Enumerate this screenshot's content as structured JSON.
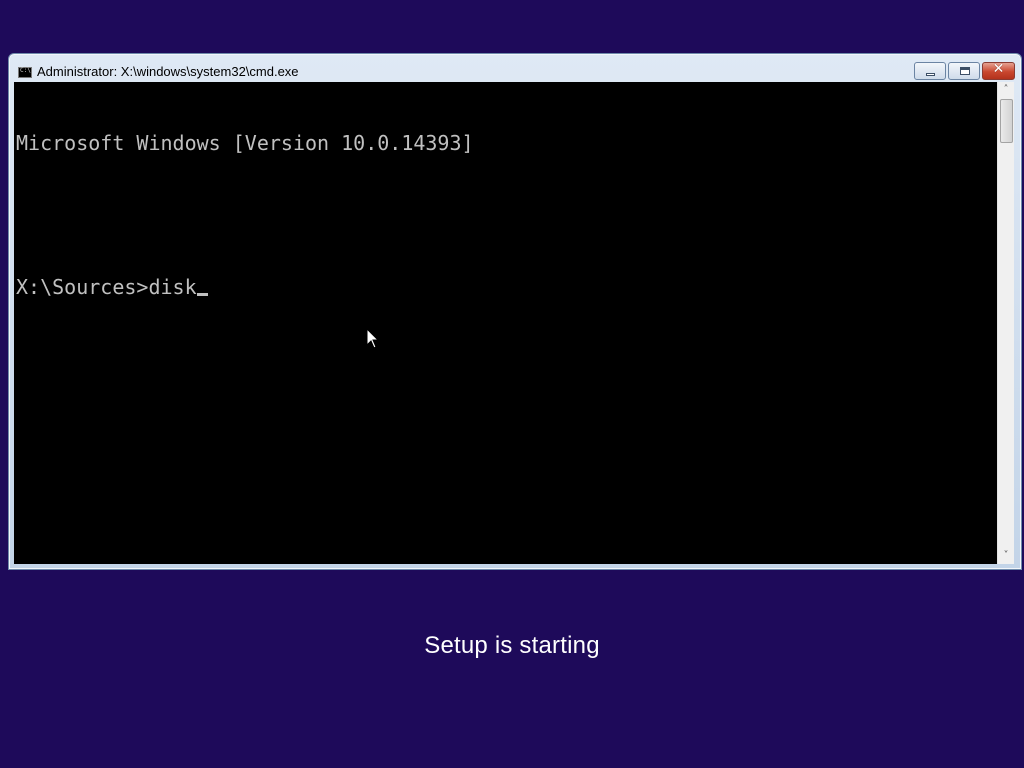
{
  "window": {
    "title": "Administrator: X:\\windows\\system32\\cmd.exe",
    "icon": "cmd-app-icon",
    "controls": {
      "minimize": "minimize-icon",
      "maximize": "maximize-icon",
      "close": "close-icon",
      "close_glyph": "✕"
    }
  },
  "console": {
    "lines": [
      "Microsoft Windows [Version 10.0.14393]",
      "",
      "X:\\Sources>disk"
    ]
  },
  "scrollbar": {
    "up_arrow": "˄",
    "down_arrow": "˅"
  },
  "setup": {
    "status": "Setup is starting"
  },
  "colors": {
    "desktop_background": "#1e0a5a",
    "console_background": "#000000",
    "console_text": "#c0c0c0"
  }
}
